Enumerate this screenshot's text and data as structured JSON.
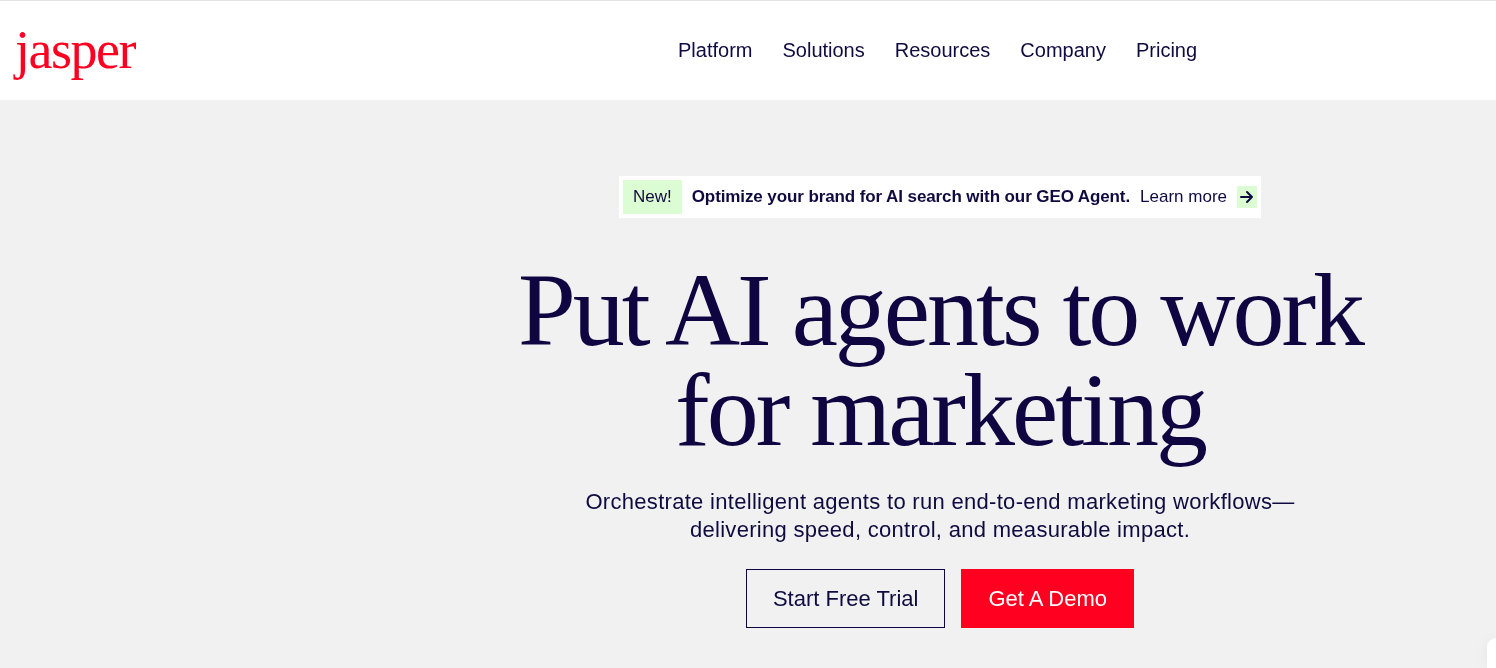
{
  "header": {
    "logo": "jasper",
    "nav": [
      {
        "label": "Platform"
      },
      {
        "label": "Solutions"
      },
      {
        "label": "Resources"
      },
      {
        "label": "Company"
      },
      {
        "label": "Pricing"
      }
    ]
  },
  "announcement": {
    "badge": "New!",
    "text": "Optimize your brand for AI search with our GEO Agent.",
    "link": "Learn more"
  },
  "hero": {
    "headline_lines": [
      "Put AI agents to work",
      "for marketing"
    ],
    "subtitle": "Orchestrate intelligent agents to run end-to-end marketing workflows—delivering speed, control, and measurable impact.",
    "buttons": [
      {
        "label": "Start Free Trial",
        "kind": "outline"
      },
      {
        "label": "Get A Demo",
        "kind": "primary"
      }
    ]
  }
}
